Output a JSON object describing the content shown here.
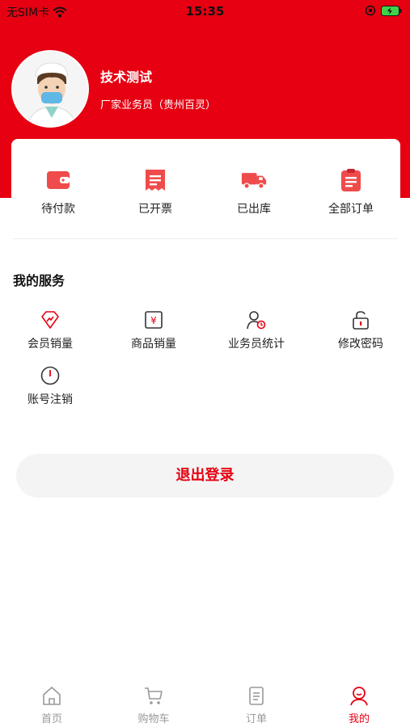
{
  "status_bar": {
    "carrier": "无SIM卡",
    "time": "15:35"
  },
  "profile": {
    "name": "技术测试",
    "role": "厂家业务员（贵州百灵）"
  },
  "orders": [
    {
      "label": "待付款",
      "icon": "wallet-icon"
    },
    {
      "label": "已开票",
      "icon": "receipt-icon"
    },
    {
      "label": "已出库",
      "icon": "truck-icon"
    },
    {
      "label": "全部订单",
      "icon": "clipboard-icon"
    }
  ],
  "services": {
    "title": "我的服务",
    "items": [
      {
        "label": "会员销量",
        "icon": "member-sales-icon"
      },
      {
        "label": "商品销量",
        "icon": "product-sales-icon"
      },
      {
        "label": "业务员统计",
        "icon": "salesman-stats-icon"
      },
      {
        "label": "修改密码",
        "icon": "lock-icon"
      },
      {
        "label": "账号注销",
        "icon": "power-icon"
      }
    ]
  },
  "logout_label": "退出登录",
  "tabs": [
    {
      "label": "首页",
      "icon": "home-icon",
      "active": false
    },
    {
      "label": "购物车",
      "icon": "cart-icon",
      "active": false
    },
    {
      "label": "订单",
      "icon": "order-list-icon",
      "active": false
    },
    {
      "label": "我的",
      "icon": "profile-icon",
      "active": true
    }
  ],
  "colors": {
    "brand": "#e60012",
    "tab_inactive": "#999999",
    "button_bg": "#f4f4f4"
  }
}
